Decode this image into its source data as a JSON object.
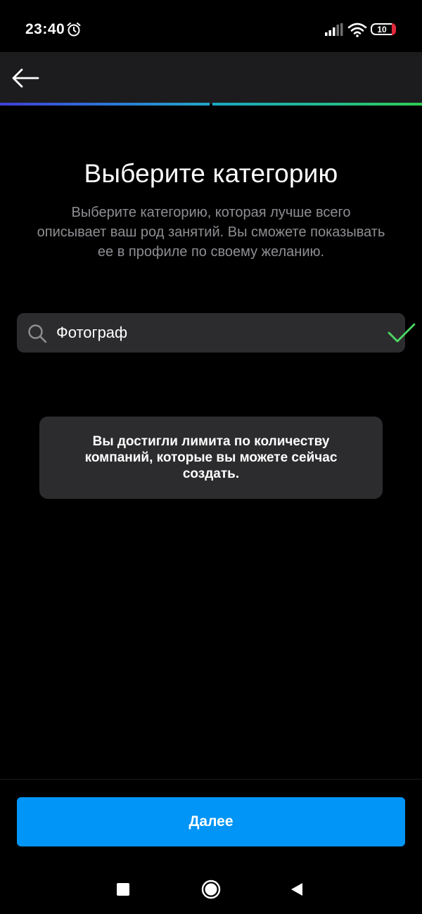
{
  "status_bar": {
    "time": "23:40",
    "battery_level": "10",
    "icons": [
      "alarm-icon",
      "signal-icon",
      "wifi-icon",
      "battery-icon"
    ]
  },
  "header": {
    "back_icon": "arrow-left-icon",
    "progress": {
      "steps": 2,
      "current": 2
    }
  },
  "content": {
    "title": "Выберите категорию",
    "subtitle": "Выберите категорию, которая лучше всего описывает ваш род занятий. Вы сможете показывать ее в профиле по своему желанию.",
    "search": {
      "value": "Фотограф",
      "icon": "search-icon",
      "status_icon": "check-icon"
    },
    "toast_message": "Вы достигли лимита по количеству компаний, которые вы можете сейчас создать."
  },
  "footer": {
    "next_label": "Далее"
  },
  "navigation": {
    "items": [
      "recents-icon",
      "home-icon",
      "back-icon"
    ]
  },
  "colors": {
    "background": "#000000",
    "surface": "#2c2c2e",
    "header": "#1c1c1e",
    "primary": "#0095f6",
    "success": "#4cd964",
    "secondary_text": "#8e8e93",
    "battery_low": "#e0283a"
  }
}
